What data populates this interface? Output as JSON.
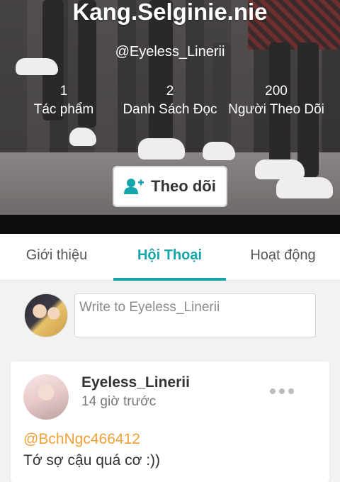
{
  "profile": {
    "display_name": "Kang.Selginie.nie",
    "handle": "@Eyeless_Linerii",
    "stats": [
      {
        "count": "1",
        "label": "Tác phẩm"
      },
      {
        "count": "2",
        "label": "Danh Sách Đọc"
      },
      {
        "count": "200",
        "label": "Người Theo Dõi"
      }
    ],
    "follow_label": "Theo dõi"
  },
  "tabs": [
    {
      "label": "Giới thiệu"
    },
    {
      "label": "Hội Thoại"
    },
    {
      "label": "Hoạt động"
    }
  ],
  "active_tab": "Hội Thoại",
  "composer": {
    "placeholder": "Write to Eyeless_Linerii"
  },
  "post": {
    "author": "Eyeless_Linerii",
    "time": "14 giờ trước",
    "mention": "@BchNgc466412",
    "text": "Tớ sợ cậu quá cơ :))"
  },
  "colors": {
    "accent": "#13a5aa",
    "mention": "#f0a035"
  },
  "icons": {
    "follow": "add-user-icon",
    "more": "more-options-icon"
  }
}
